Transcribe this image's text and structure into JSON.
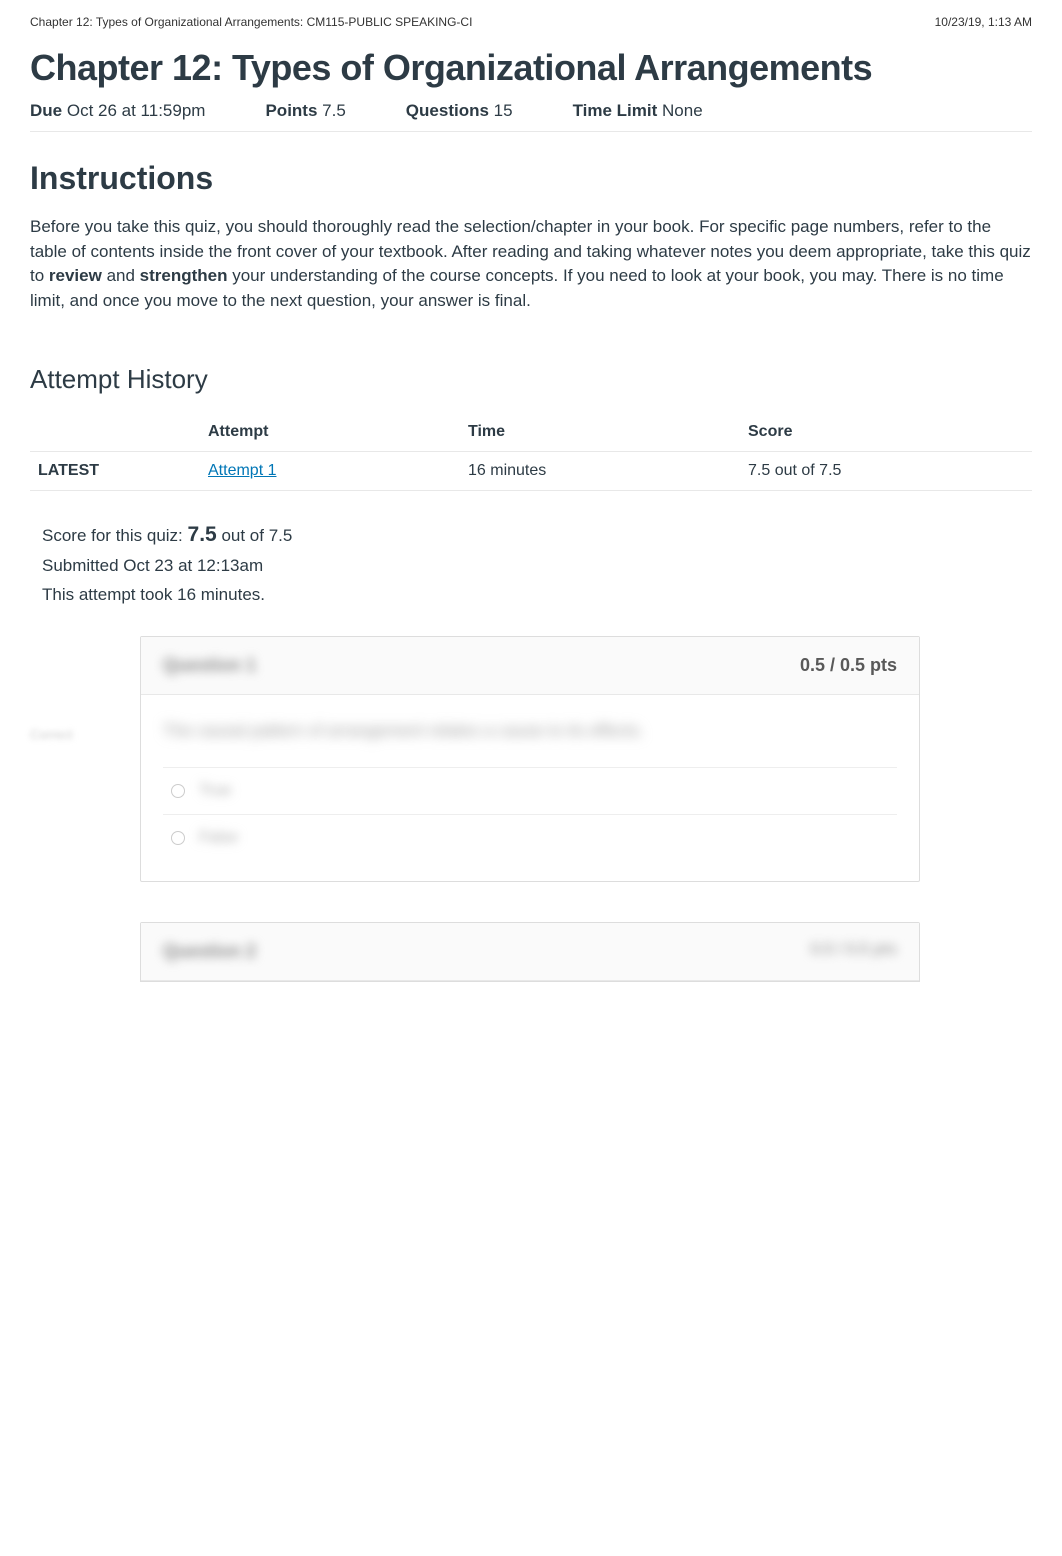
{
  "header": {
    "breadcrumb": "Chapter 12: Types of Organizational Arrangements: CM115-PUBLIC SPEAKING-CI",
    "timestamp": "10/23/19, 1:13 AM"
  },
  "title": "Chapter 12: Types of Organizational Arrangements",
  "meta": {
    "due_label": "Due",
    "due_value": "Oct 26 at 11:59pm",
    "points_label": "Points",
    "points_value": "7.5",
    "questions_label": "Questions",
    "questions_value": "15",
    "timelimit_label": "Time Limit",
    "timelimit_value": "None"
  },
  "instructions": {
    "heading": "Instructions",
    "body_pre": "Before you take this quiz, you should thoroughly read the selection/chapter in your book. For specific page numbers, refer to the table of contents inside the front cover of your textbook. After reading and taking whatever notes you deem appropriate, take this quiz to ",
    "review": "review",
    "mid": " and ",
    "strengthen": "strengthen",
    "body_post": " your understanding of the course concepts. If you need to look at your book, you may. There is no time limit, and once you move to the next question, your answer is final."
  },
  "attempt_history": {
    "heading": "Attempt History",
    "headers": {
      "attempt": "Attempt",
      "time": "Time",
      "score": "Score"
    },
    "rows": [
      {
        "latest": "LATEST",
        "attempt": "Attempt 1",
        "time": "16 minutes",
        "score": "7.5 out of 7.5"
      }
    ]
  },
  "score_block": {
    "line1_pre": "Score for this quiz: ",
    "line1_score": "7.5",
    "line1_post": " out of 7.5",
    "line2": "Submitted Oct 23 at 12:13am",
    "line3": "This attempt took 16 minutes."
  },
  "question1": {
    "side_label": "Correct",
    "title": "Question 1",
    "pts": "0.5 / 0.5 pts",
    "body": "The causal pattern of arrangement relates a cause to its effects.",
    "ans1": "True",
    "ans2": "False"
  },
  "question2": {
    "title": "Question 2",
    "pts": "0.5 / 0.5 pts"
  }
}
